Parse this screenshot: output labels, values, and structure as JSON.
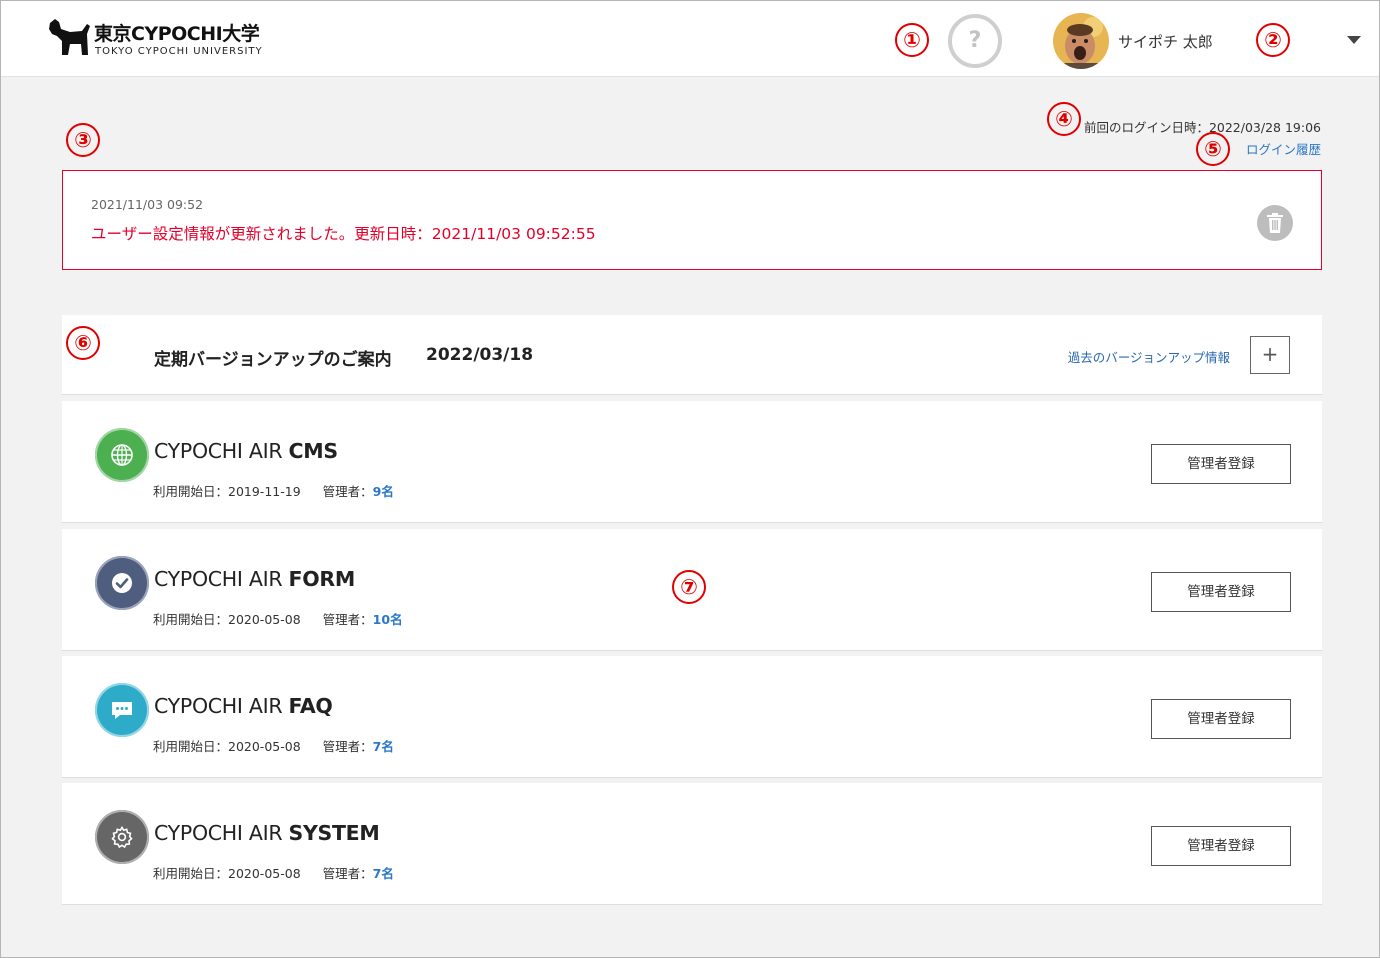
{
  "header": {
    "logo_name": "東京CYPOCHI大学",
    "logo_sub": "TOKYO CYPOCHI UNIVERSITY",
    "help_label": "?",
    "user_name": "サイポチ 太郎"
  },
  "markers": [
    "①",
    "②",
    "③",
    "④",
    "⑤",
    "⑥",
    "⑦"
  ],
  "login": {
    "last_login": "前回のログイン日時：2022/03/28 19:06",
    "history_link": "ログイン履歴"
  },
  "notice": {
    "date": "2021/11/03 09:52",
    "message": "ユーザー設定情報が更新されました。更新日時：2021/11/03 09:52:55"
  },
  "version": {
    "title": "定期バージョンアップのご案内",
    "date": "2022/03/18",
    "past_link": "過去のバージョンアップ情報",
    "expand_label": "+"
  },
  "services": [
    {
      "prefix": "CYPOCHI AIR ",
      "name": "CMS",
      "start_label": "利用開始日：2019-11-19",
      "admin_label": "管理者：",
      "admin_count": "9名",
      "button": "管理者登録",
      "icon": "globe-icon",
      "color": "#4caf50"
    },
    {
      "prefix": "CYPOCHI AIR ",
      "name": "FORM",
      "start_label": "利用開始日：2020-05-08",
      "admin_label": "管理者：",
      "admin_count": "10名",
      "button": "管理者登録",
      "icon": "check-icon",
      "color": "#4f5d7e"
    },
    {
      "prefix": "CYPOCHI AIR ",
      "name": "FAQ",
      "start_label": "利用開始日：2020-05-08",
      "admin_label": "管理者：",
      "admin_count": "7名",
      "button": "管理者登録",
      "icon": "chat-icon",
      "color": "#2eabc8"
    },
    {
      "prefix": "CYPOCHI AIR ",
      "name": "SYSTEM",
      "start_label": "利用開始日：2020-05-08",
      "admin_label": "管理者：",
      "admin_count": "7名",
      "button": "管理者登録",
      "icon": "gear-icon",
      "color": "#666666"
    }
  ],
  "colors": {
    "accent_red": "#e4002b",
    "link_blue": "#2a77c7"
  }
}
